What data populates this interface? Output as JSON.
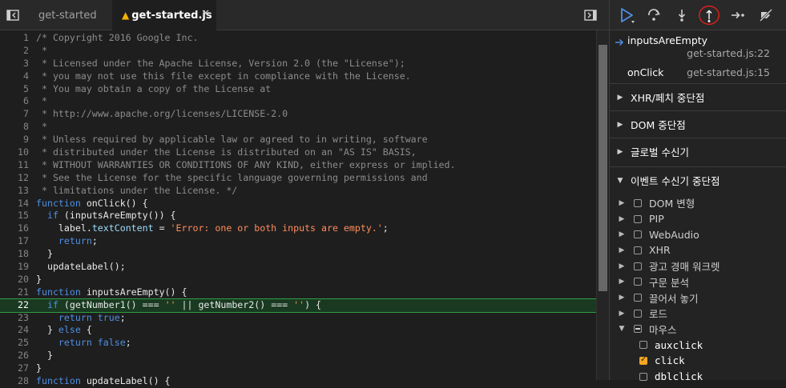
{
  "editor": {
    "tabs": [
      {
        "label": "get-started",
        "active": false
      },
      {
        "label": "get-started.js",
        "active": true,
        "warning": true
      }
    ],
    "lines": [
      {
        "n": "1",
        "parts": [
          [
            "c",
            "/* Copyright 2016 Google Inc."
          ]
        ]
      },
      {
        "n": "2",
        "parts": [
          [
            "c",
            " *"
          ]
        ]
      },
      {
        "n": "3",
        "parts": [
          [
            "c",
            " * Licensed under the Apache License, Version 2.0 (the \"License\");"
          ]
        ]
      },
      {
        "n": "4",
        "parts": [
          [
            "c",
            " * you may not use this file except in compliance with the License."
          ]
        ]
      },
      {
        "n": "5",
        "parts": [
          [
            "c",
            " * You may obtain a copy of the License at"
          ]
        ]
      },
      {
        "n": "6",
        "parts": [
          [
            "c",
            " *"
          ]
        ]
      },
      {
        "n": "7",
        "parts": [
          [
            "c",
            " * http://www.apache.org/licenses/LICENSE-2.0"
          ]
        ]
      },
      {
        "n": "8",
        "parts": [
          [
            "c",
            " *"
          ]
        ]
      },
      {
        "n": "9",
        "parts": [
          [
            "c",
            " * Unless required by applicable law or agreed to in writing, software"
          ]
        ]
      },
      {
        "n": "10",
        "parts": [
          [
            "c",
            " * distributed under the License is distributed on an \"AS IS\" BASIS,"
          ]
        ]
      },
      {
        "n": "11",
        "parts": [
          [
            "c",
            " * WITHOUT WARRANTIES OR CONDITIONS OF ANY KIND, either express or implied."
          ]
        ]
      },
      {
        "n": "12",
        "parts": [
          [
            "c",
            " * See the License for the specific language governing permissions and"
          ]
        ]
      },
      {
        "n": "13",
        "parts": [
          [
            "c",
            " * limitations under the License. */"
          ]
        ]
      },
      {
        "n": "14",
        "parts": [
          [
            "k",
            "function"
          ],
          [
            "f",
            " onClick() {"
          ]
        ]
      },
      {
        "n": "15",
        "parts": [
          [
            "f",
            "  "
          ],
          [
            "k",
            "if"
          ],
          [
            "f",
            " (inputsAreEmpty()) {"
          ]
        ]
      },
      {
        "n": "16",
        "parts": [
          [
            "f",
            "    label."
          ],
          [
            "p",
            "textContent"
          ],
          [
            "f",
            " = "
          ],
          [
            "s",
            "'Error: one or both inputs are empty.'"
          ],
          [
            "f",
            ";"
          ]
        ]
      },
      {
        "n": "17",
        "parts": [
          [
            "f",
            "    "
          ],
          [
            "k",
            "return"
          ],
          [
            "f",
            ";"
          ]
        ]
      },
      {
        "n": "18",
        "parts": [
          [
            "f",
            "  }"
          ]
        ]
      },
      {
        "n": "19",
        "parts": [
          [
            "f",
            "  updateLabel();"
          ]
        ]
      },
      {
        "n": "20",
        "parts": [
          [
            "f",
            "}"
          ]
        ]
      },
      {
        "n": "21",
        "parts": [
          [
            "k",
            "function"
          ],
          [
            "f",
            " inputsAreEmpty() {"
          ]
        ]
      },
      {
        "n": "22",
        "highlight": true,
        "parts": [
          [
            "f",
            "  "
          ],
          [
            "k",
            "if"
          ],
          [
            "f",
            " (getNumber1() === "
          ],
          [
            "s",
            "''"
          ],
          [
            "f",
            " || getNumber2() === "
          ],
          [
            "s",
            "''"
          ],
          [
            "f",
            ") {"
          ]
        ]
      },
      {
        "n": "23",
        "parts": [
          [
            "f",
            "    "
          ],
          [
            "k",
            "return"
          ],
          [
            "f",
            " "
          ],
          [
            "k",
            "true"
          ],
          [
            "f",
            ";"
          ]
        ]
      },
      {
        "n": "24",
        "parts": [
          [
            "f",
            "  } "
          ],
          [
            "k",
            "else"
          ],
          [
            "f",
            " {"
          ]
        ]
      },
      {
        "n": "25",
        "parts": [
          [
            "f",
            "    "
          ],
          [
            "k",
            "return"
          ],
          [
            "f",
            " "
          ],
          [
            "k",
            "false"
          ],
          [
            "f",
            ";"
          ]
        ]
      },
      {
        "n": "26",
        "parts": [
          [
            "f",
            "  }"
          ]
        ]
      },
      {
        "n": "27",
        "parts": [
          [
            "f",
            "}"
          ]
        ]
      },
      {
        "n": "28",
        "parts": [
          [
            "k",
            "function"
          ],
          [
            "f",
            " updateLabel() {"
          ]
        ]
      }
    ]
  },
  "debugger": {
    "toolbar": [
      "resume-icon",
      "step-over-icon",
      "step-into-icon",
      "step-out-icon",
      "step-icon",
      "deactivate-breakpoints-icon"
    ],
    "callstack": [
      {
        "fn": "inputsAreEmpty",
        "loc": "get-started.js:22",
        "current": true
      },
      {
        "fn": "onClick",
        "loc": "get-started.js:15",
        "current": false
      }
    ],
    "sections": [
      "XHR/페치 중단점",
      "DOM 중단점",
      "글로벌 수신기",
      "이벤트 수신기 중단점"
    ],
    "events": [
      {
        "label": "DOM 변형",
        "expanded": false
      },
      {
        "label": "PIP",
        "expanded": false
      },
      {
        "label": "WebAudio",
        "expanded": false
      },
      {
        "label": "XHR",
        "expanded": false
      },
      {
        "label": "광고 경매 워크렛",
        "expanded": false
      },
      {
        "label": "구문 분석",
        "expanded": false
      },
      {
        "label": "끌어서 놓기",
        "expanded": false
      },
      {
        "label": "로드",
        "expanded": false
      },
      {
        "label": "마우스",
        "expanded": true,
        "partial": true
      }
    ],
    "mouse_events": [
      {
        "label": "auxclick",
        "checked": false
      },
      {
        "label": "click",
        "checked": true
      },
      {
        "label": "dblclick",
        "checked": false
      }
    ]
  },
  "colors": {
    "accent": "#f3a720",
    "highlight": "#193a21",
    "annotation": "#e0201b"
  }
}
